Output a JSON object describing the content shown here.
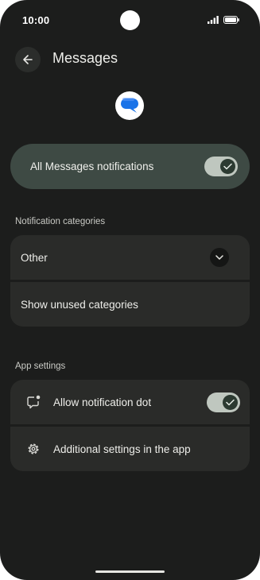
{
  "status_bar": {
    "time": "10:00"
  },
  "header": {
    "title": "Messages"
  },
  "app": {
    "icon": "messages-app-icon",
    "brand_color": "#1a73e8"
  },
  "master_toggle": {
    "label": "All Messages notifications",
    "on": true
  },
  "categories": {
    "heading": "Notification categories",
    "items": [
      {
        "label": "Other"
      },
      {
        "label": "Show unused categories"
      }
    ]
  },
  "app_settings": {
    "heading": "App settings",
    "items": [
      {
        "label": "Allow notification dot",
        "icon": "notification-dot-icon",
        "on": true
      },
      {
        "label": "Additional settings in the app",
        "icon": "gear-icon"
      }
    ]
  },
  "colors": {
    "background": "#1c1d1c",
    "card": "#2a2b29",
    "master_card": "#3e4a44",
    "toggle_track": "#bfc7bf"
  }
}
